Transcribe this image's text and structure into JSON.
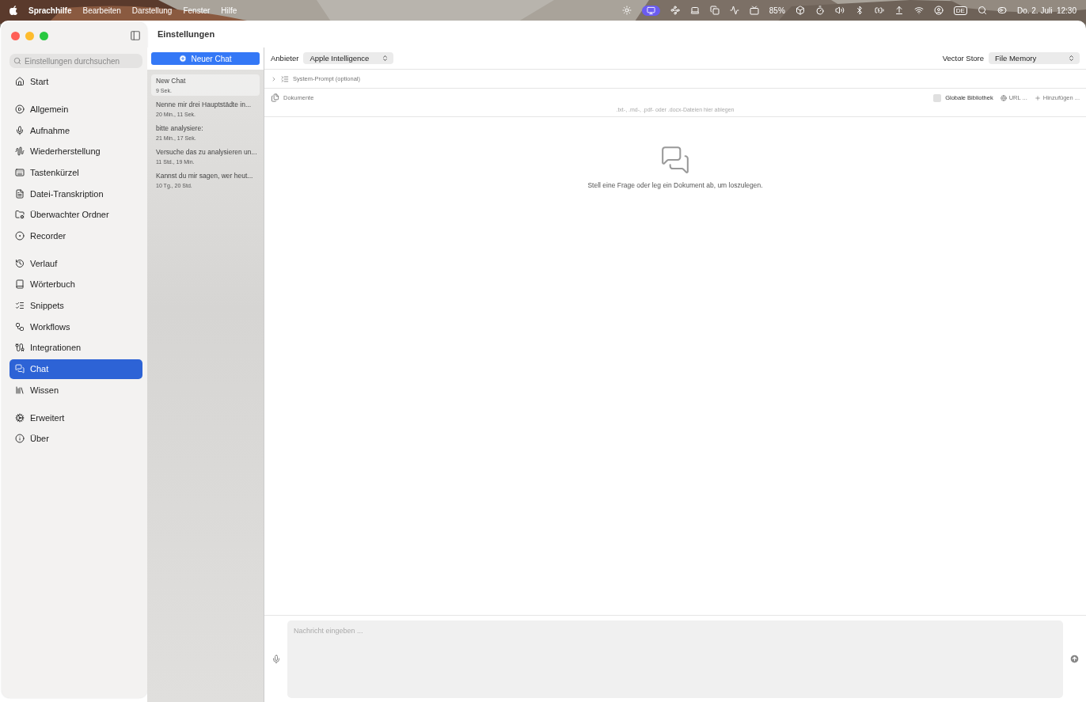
{
  "menu_bar": {
    "app_name": "Sprachhilfe",
    "menus": [
      "Bearbeiten",
      "Darstellung",
      "Fenster",
      "Hilfe"
    ],
    "battery": "85%",
    "input_source": "DE",
    "clock": "Do. 2. Juli  12:30"
  },
  "window": {
    "title": "Einstellungen"
  },
  "sidebar": {
    "search": {
      "placeholder": "Einstellungen durchsuchen"
    },
    "groups": [
      [
        {
          "label": "Start",
          "selected": false
        }
      ],
      [
        {
          "label": "Allgemein",
          "selected": false
        },
        {
          "label": "Aufnahme",
          "selected": false
        },
        {
          "label": "Wiederherstellung",
          "selected": false
        },
        {
          "label": "Tastenkürzel",
          "selected": false
        },
        {
          "label": "Datei-Transkription",
          "selected": false
        },
        {
          "label": "Überwachter Ordner",
          "selected": false
        },
        {
          "label": "Recorder",
          "selected": false
        }
      ],
      [
        {
          "label": "Verlauf",
          "selected": false
        },
        {
          "label": "Wörterbuch",
          "selected": false
        },
        {
          "label": "Snippets",
          "selected": false
        },
        {
          "label": "Workflows",
          "selected": false
        },
        {
          "label": "Integrationen",
          "selected": false
        },
        {
          "label": "Chat",
          "selected": true
        },
        {
          "label": "Wissen",
          "selected": false
        }
      ],
      [
        {
          "label": "Erweitert",
          "selected": false
        },
        {
          "label": "Über",
          "selected": false
        }
      ]
    ]
  },
  "chat_list": {
    "new_button": "Neuer Chat",
    "chats": [
      {
        "title": "New Chat",
        "age": "9 Sek.",
        "selected": true
      },
      {
        "title": "Nenne mir drei Hauptstädte in...",
        "age": "20 Min., 11 Sek.",
        "selected": false
      },
      {
        "title": "bitte analysiere:",
        "age": "21 Min., 17 Sek.",
        "selected": false
      },
      {
        "title": "Versuche das zu analysieren un...",
        "age": "11 Std., 19 Min.",
        "selected": false
      },
      {
        "title": "Kannst du mir sagen, wer heut...",
        "age": "10 Tg., 20 Std.",
        "selected": false
      }
    ]
  },
  "toolbar": {
    "provider_label": "Anbieter",
    "provider": "Apple Intelligence",
    "vector_label": "Vector Store",
    "vector_store": "File Memory"
  },
  "system_prompt": {
    "label": "System-Prompt (optional)",
    "expanded": false
  },
  "documents": {
    "label": "Dokumente",
    "global_library": {
      "label": "Globale Bibliothek",
      "checked": false
    },
    "url_button": "URL ...",
    "add_button": "Hinzufügen ...",
    "drop_hint": ".txt-, .md-, .pdf- oder .docx-Dateien hier ablegen"
  },
  "empty_state": {
    "text": "Stell eine Frage oder leg ein Dokument ab, um loszulegen."
  },
  "composer": {
    "placeholder": "Nachricht eingeben ..."
  }
}
